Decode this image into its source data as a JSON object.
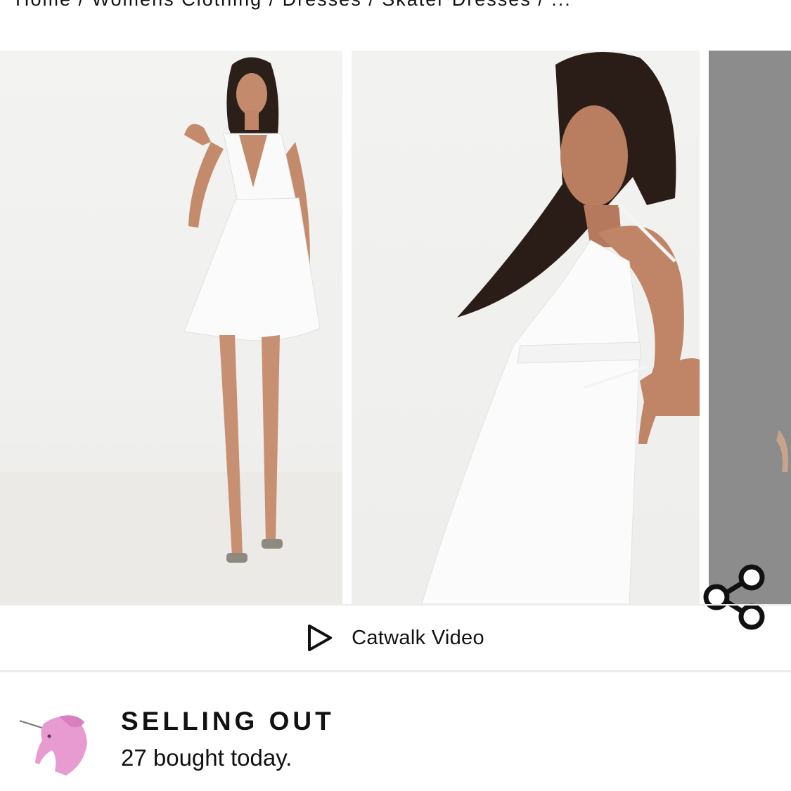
{
  "breadcrumb": {
    "items": [
      "Home",
      "Womens Clothing",
      "Dresses",
      "Skater Dresses",
      "..."
    ],
    "separator": " / "
  },
  "gallery": {
    "images": [
      {
        "alt": "model-front-white-dress-icon"
      },
      {
        "alt": "model-side-white-dress-icon"
      },
      {
        "alt": "model-third-image-partial-icon"
      }
    ],
    "share_icon": "share-icon"
  },
  "catwalk": {
    "icon": "play-icon",
    "label": "Catwalk Video"
  },
  "selling": {
    "icon": "unicorn-icon",
    "title": "SELLING OUT",
    "subtitle": "27 bought today."
  },
  "colors": {
    "text": "#111111",
    "divider": "#ececec",
    "unicorn": "#e79bd1"
  }
}
